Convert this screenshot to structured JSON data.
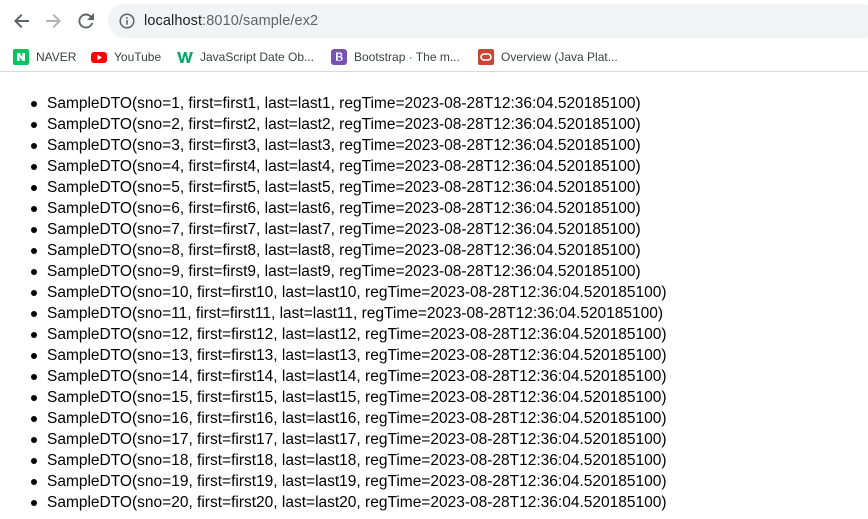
{
  "browser": {
    "url_host": "localhost",
    "url_rest": ":8010/sample/ex2",
    "icons": {
      "back": "back-arrow-icon",
      "forward": "forward-arrow-icon",
      "reload": "reload-icon",
      "info": "info-icon"
    }
  },
  "bookmarks": [
    {
      "label": "NAVER",
      "icon": "naver-icon",
      "color": "#03c75a"
    },
    {
      "label": "YouTube",
      "icon": "youtube-icon",
      "color": "#ff0000"
    },
    {
      "label": "JavaScript Date Ob...",
      "icon": "w3schools-icon",
      "color": "#04aa6d"
    },
    {
      "label": "Bootstrap · The m...",
      "icon": "bootstrap-icon",
      "color": "#7952b3"
    },
    {
      "label": "Overview (Java Plat...",
      "icon": "oracle-icon",
      "color": "#c74634"
    }
  ],
  "items": [
    "SampleDTO(sno=1, first=first1, last=last1, regTime=2023-08-28T12:36:04.520185100)",
    "SampleDTO(sno=2, first=first2, last=last2, regTime=2023-08-28T12:36:04.520185100)",
    "SampleDTO(sno=3, first=first3, last=last3, regTime=2023-08-28T12:36:04.520185100)",
    "SampleDTO(sno=4, first=first4, last=last4, regTime=2023-08-28T12:36:04.520185100)",
    "SampleDTO(sno=5, first=first5, last=last5, regTime=2023-08-28T12:36:04.520185100)",
    "SampleDTO(sno=6, first=first6, last=last6, regTime=2023-08-28T12:36:04.520185100)",
    "SampleDTO(sno=7, first=first7, last=last7, regTime=2023-08-28T12:36:04.520185100)",
    "SampleDTO(sno=8, first=first8, last=last8, regTime=2023-08-28T12:36:04.520185100)",
    "SampleDTO(sno=9, first=first9, last=last9, regTime=2023-08-28T12:36:04.520185100)",
    "SampleDTO(sno=10, first=first10, last=last10, regTime=2023-08-28T12:36:04.520185100)",
    "SampleDTO(sno=11, first=first11, last=last11, regTime=2023-08-28T12:36:04.520185100)",
    "SampleDTO(sno=12, first=first12, last=last12, regTime=2023-08-28T12:36:04.520185100)",
    "SampleDTO(sno=13, first=first13, last=last13, regTime=2023-08-28T12:36:04.520185100)",
    "SampleDTO(sno=14, first=first14, last=last14, regTime=2023-08-28T12:36:04.520185100)",
    "SampleDTO(sno=15, first=first15, last=last15, regTime=2023-08-28T12:36:04.520185100)",
    "SampleDTO(sno=16, first=first16, last=last16, regTime=2023-08-28T12:36:04.520185100)",
    "SampleDTO(sno=17, first=first17, last=last17, regTime=2023-08-28T12:36:04.520185100)",
    "SampleDTO(sno=18, first=first18, last=last18, regTime=2023-08-28T12:36:04.520185100)",
    "SampleDTO(sno=19, first=first19, last=last19, regTime=2023-08-28T12:36:04.520185100)",
    "SampleDTO(sno=20, first=first20, last=last20, regTime=2023-08-28T12:36:04.520185100)"
  ]
}
